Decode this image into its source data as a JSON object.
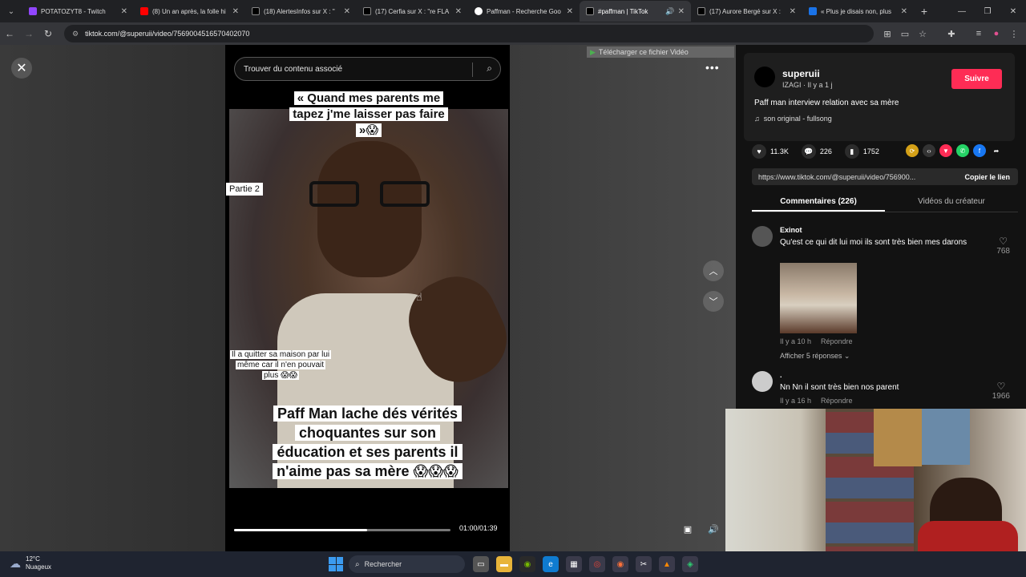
{
  "browser": {
    "tabs": [
      {
        "title": "POTATOZYT8 - Twitch",
        "color": "#9146ff"
      },
      {
        "title": "(8) Un an après, la folle hi",
        "color": "#ff0000"
      },
      {
        "title": "(18) AlertesInfos sur X : \"",
        "color": "#000000"
      },
      {
        "title": "(17) Cerfia sur X : \"re FLA",
        "color": "#000000"
      },
      {
        "title": "Paffman - Recherche Goo",
        "color": "#4285f4"
      },
      {
        "title": "#paffman | TikTok",
        "color": "#000000"
      },
      {
        "title": "(17) Aurore Bergé sur X :",
        "color": "#000000"
      },
      {
        "title": "« Plus je disais non, plus",
        "color": "#1a73e8"
      }
    ],
    "url": "tiktok.com/@superuii/video/7569004516570402070"
  },
  "video": {
    "search_placeholder": "Trouver du contenu associé",
    "caption_top": "« Quand mes parents me tapez j'me laisser pas faire »😱",
    "tag": "Partie 2",
    "caption_mid": "Il a quitter sa maison par lui même car il n'en pouvait plus 😱😱",
    "caption_main": "Paff Man lache dés vérités choquantes sur son éducation et ses parents il n'aime pas sa mère 😱😱😱",
    "time": "01:00/01:39",
    "progress": 0.613,
    "download_label": "Télécharger ce fichier Vidéo"
  },
  "panel": {
    "username": "superuii",
    "meta": "IZAGI · Il y a 1 j",
    "follow_label": "Suivre",
    "description": "Paff man interview relation avec sa mère",
    "music": "son original - fullsong",
    "likes": "11.3K",
    "comments_count": "226",
    "saves": "1752",
    "link": "https://www.tiktok.com/@superuii/video/756900...",
    "copy_label": "Copier le lien",
    "tab_comments": "Commentaires (226)",
    "tab_creator": "Vidéos du créateur"
  },
  "comments": [
    {
      "user": "Exinot",
      "text": "Qu'est ce qui dit lui moi ils sont très bien mes darons",
      "time": "Il y a 10 h",
      "reply": "Répondre",
      "likes": "768",
      "replies": "Afficher 5 réponses"
    },
    {
      "user": ".",
      "text": "Nn Nn il sont très bien nos parent",
      "time": "Il y a 16 h",
      "reply": "Répondre",
      "likes": "1966"
    }
  ],
  "taskbar": {
    "temp": "12°C",
    "weather": "Nuageux",
    "search": "Rechercher"
  }
}
